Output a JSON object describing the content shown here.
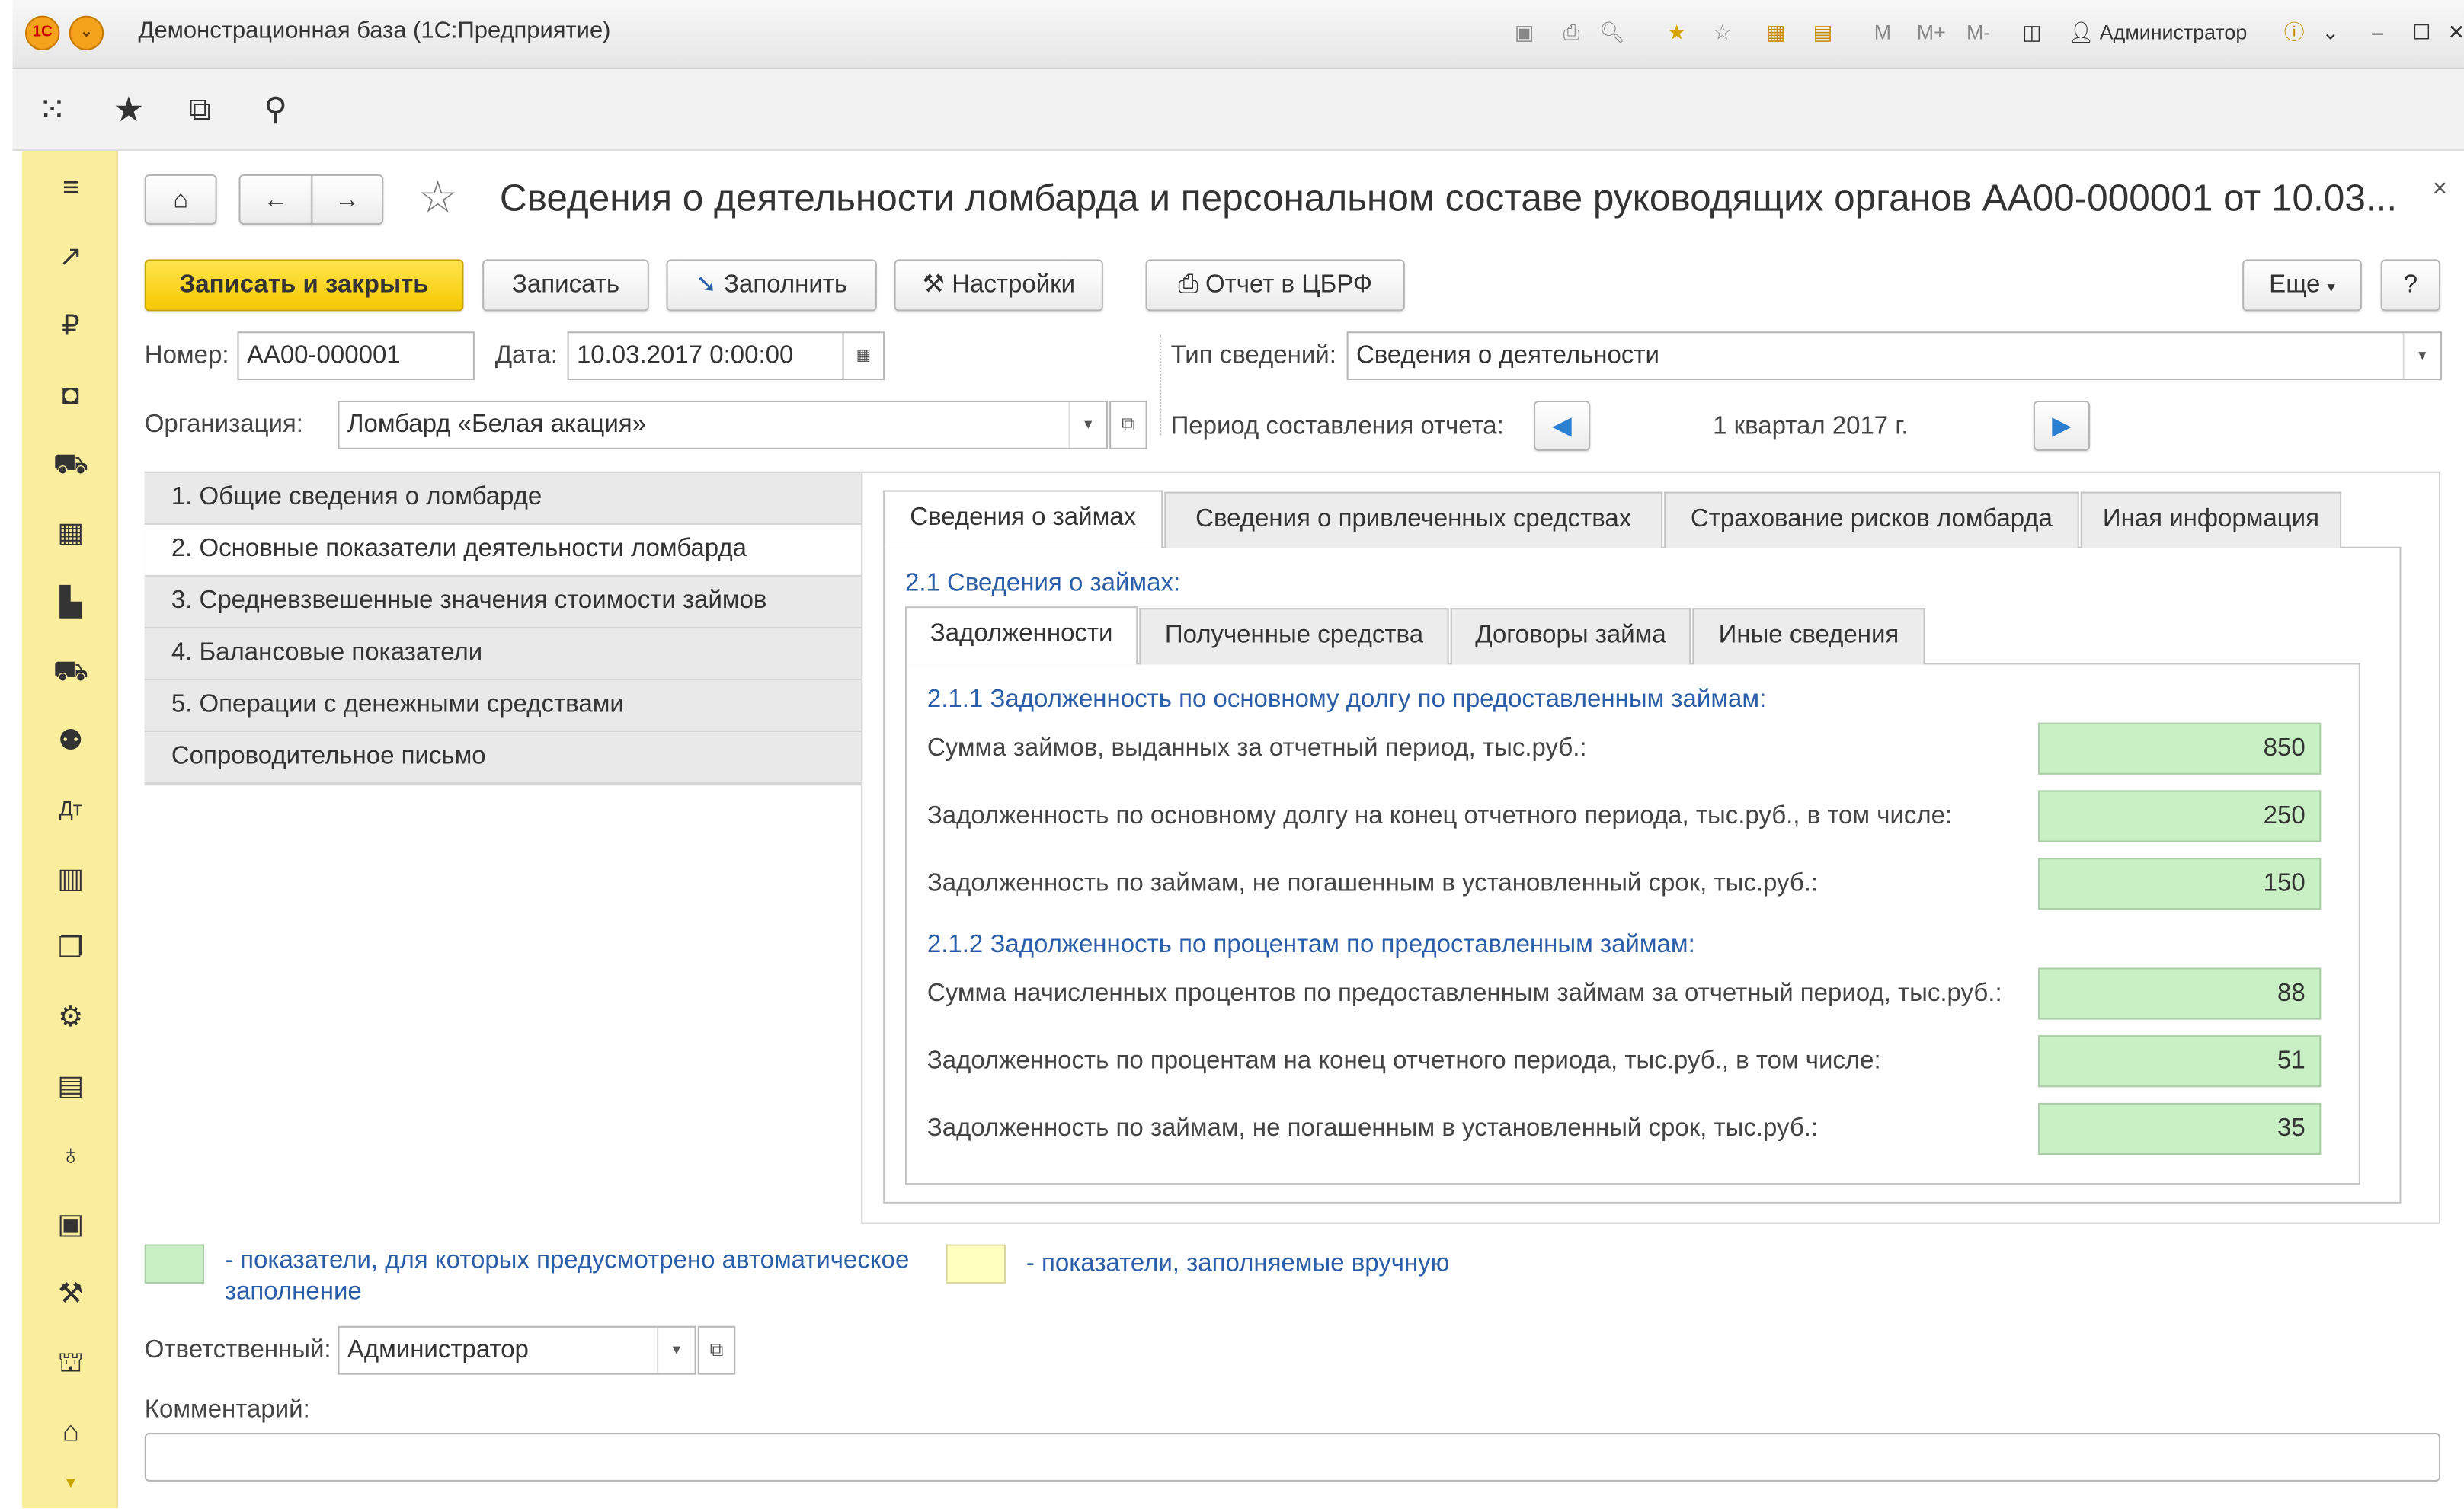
{
  "window": {
    "title": "Демонстрационная база  (1С:Предприятие)",
    "user": "Администратор",
    "memory_buttons": [
      "M",
      "M+",
      "M-"
    ]
  },
  "form": {
    "title": "Сведения о деятельности ломбарда и персональном составе руководящих органов АА00-000001 от 10.03...",
    "buttons": {
      "save_close": "Записать и закрыть",
      "save": "Записать",
      "fill": "Заполнить",
      "settings": "Настройки",
      "report": "Отчет в ЦБРФ",
      "more": "Еще",
      "help": "?"
    },
    "number_label": "Номер:",
    "number_value": "АА00-000001",
    "date_label": "Дата:",
    "date_value": "10.03.2017  0:00:00",
    "type_label": "Тип сведений:",
    "type_value": "Сведения о деятельности",
    "org_label": "Организация:",
    "org_value": "Ломбард «Белая акация»",
    "period_label": "Период составления отчета:",
    "period_value": "1 квартал 2017 г.",
    "sections": [
      "1. Общие сведения о ломбарде",
      "2. Основные показатели деятельности ломбарда",
      "3. Средневзвешенные значения стоимости займов",
      "4. Балансовые показатели",
      "5. Операции с денежными средствами",
      "Сопроводительное письмо"
    ],
    "tabs": [
      "Сведения о займах",
      "Сведения о привлеченных средствах",
      "Страхование рисков ломбарда",
      "Иная информация"
    ],
    "group_title": "2.1 Сведения о займах:",
    "subtabs": [
      "Задолженности",
      "Полученные средства",
      "Договоры займа",
      "Иные сведения"
    ],
    "block1_title": "2.1.1 Задолженность по основному долгу по предоставленным займам:",
    "block2_title": "2.1.2 Задолженность по процентам по предоставленным займам:",
    "rows": [
      {
        "label": "Сумма займов, выданных за отчетный период, тыс.руб.:",
        "value": "850"
      },
      {
        "label": "Задолженность по основному долгу на конец отчетного периода, тыс.руб., в том числе:",
        "value": "250"
      },
      {
        "label": "Задолженность по займам, не погашенным в установленный срок, тыс.руб.:",
        "value": "150"
      },
      {
        "label": "Сумма начисленных процентов по предоставленным займам за отчетный период, тыс.руб.:",
        "value": "88"
      },
      {
        "label": "Задолженность по процентам на конец отчетного периода, тыс.руб., в том числе:",
        "value": "51"
      },
      {
        "label": "Задолженность по займам, не погашенным в установленный срок, тыс.руб.:",
        "value": "35"
      }
    ],
    "legend_auto_line1": "- показатели, для которых предусмотрено автоматическое",
    "legend_auto_line2": "заполнение",
    "legend_manual": "- показатели, заполняемые вручную",
    "responsible_label": "Ответственный:",
    "responsible_value": "Администратор",
    "comment_label": "Комментарий:",
    "comment_value": ""
  },
  "colors": {
    "sidebar": "#fbed9e",
    "auto_fill": "#c8f0c4",
    "manual_fill": "#ffffc0",
    "primary_button": "#f5c800",
    "link_blue": "#2a5ea8"
  }
}
